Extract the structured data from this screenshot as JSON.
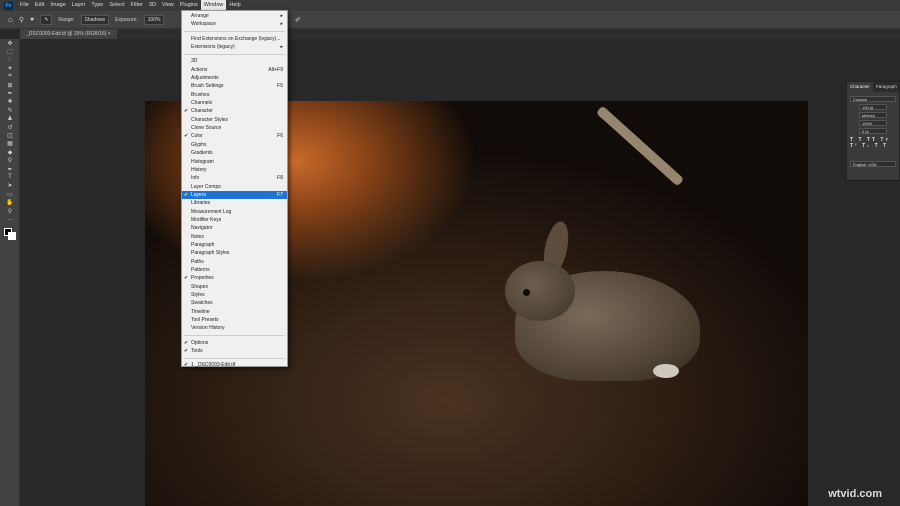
{
  "menubar": {
    "logo": "Ps",
    "items": [
      "File",
      "Edit",
      "Image",
      "Layer",
      "Type",
      "Select",
      "Filter",
      "3D",
      "View",
      "Plugins",
      "Window",
      "Help"
    ]
  },
  "options": {
    "range_label": "Range:",
    "range_value": "Shadows",
    "exposure_label": "Exposure:",
    "exposure_value": "100%"
  },
  "document_tab": {
    "title": "_DSC0093-Edit.tif @ 25% (RGB/16)"
  },
  "window_menu": {
    "group1": [
      {
        "label": "Arrange",
        "submenu": true
      },
      {
        "label": "Workspace",
        "submenu": true
      }
    ],
    "group2": [
      {
        "label": "Find Extensions on Exchange (legacy)..."
      },
      {
        "label": "Extensions (legacy)",
        "submenu": true
      }
    ],
    "group3": [
      {
        "label": "3D"
      },
      {
        "label": "Actions",
        "shortcut": "Alt+F9"
      },
      {
        "label": "Adjustments"
      },
      {
        "label": "Brush Settings",
        "shortcut": "F5"
      },
      {
        "label": "Brushes"
      },
      {
        "label": "Channels"
      },
      {
        "label": "Character",
        "checked": true
      },
      {
        "label": "Character Styles"
      },
      {
        "label": "Clone Source"
      },
      {
        "label": "Color",
        "shortcut": "F6",
        "checked": true
      },
      {
        "label": "Glyphs"
      },
      {
        "label": "Gradients"
      },
      {
        "label": "Histogram"
      },
      {
        "label": "History"
      },
      {
        "label": "Info",
        "shortcut": "F8"
      },
      {
        "label": "Layer Comps"
      },
      {
        "label": "Layers",
        "shortcut": "F7",
        "checked": true,
        "highlighted": true
      },
      {
        "label": "Libraries"
      },
      {
        "label": "Measurement Log"
      },
      {
        "label": "Modifier Keys"
      },
      {
        "label": "Navigator"
      },
      {
        "label": "Notes"
      },
      {
        "label": "Paragraph"
      },
      {
        "label": "Paragraph Styles"
      },
      {
        "label": "Paths"
      },
      {
        "label": "Patterns"
      },
      {
        "label": "Properties",
        "checked": true
      },
      {
        "label": "Shapes"
      },
      {
        "label": "Styles"
      },
      {
        "label": "Swatches"
      },
      {
        "label": "Timeline"
      },
      {
        "label": "Tool Presets"
      },
      {
        "label": "Version History"
      }
    ],
    "group4": [
      {
        "label": "Options",
        "checked": true
      },
      {
        "label": "Tools",
        "checked": true
      }
    ],
    "group5": [
      {
        "label": "1 _DSC0093-Edit.tif",
        "checked": true
      }
    ]
  },
  "character_panel": {
    "tabs": [
      "Character",
      "Paragraph"
    ],
    "font": "Couture",
    "size": "100 pt",
    "leading": "Metrics",
    "scale": "100%",
    "baseline": "0 pt",
    "styles": "T T TT Tт T¹ T₁ T T",
    "language": "English: USA"
  },
  "watermark": "wtvid.com"
}
